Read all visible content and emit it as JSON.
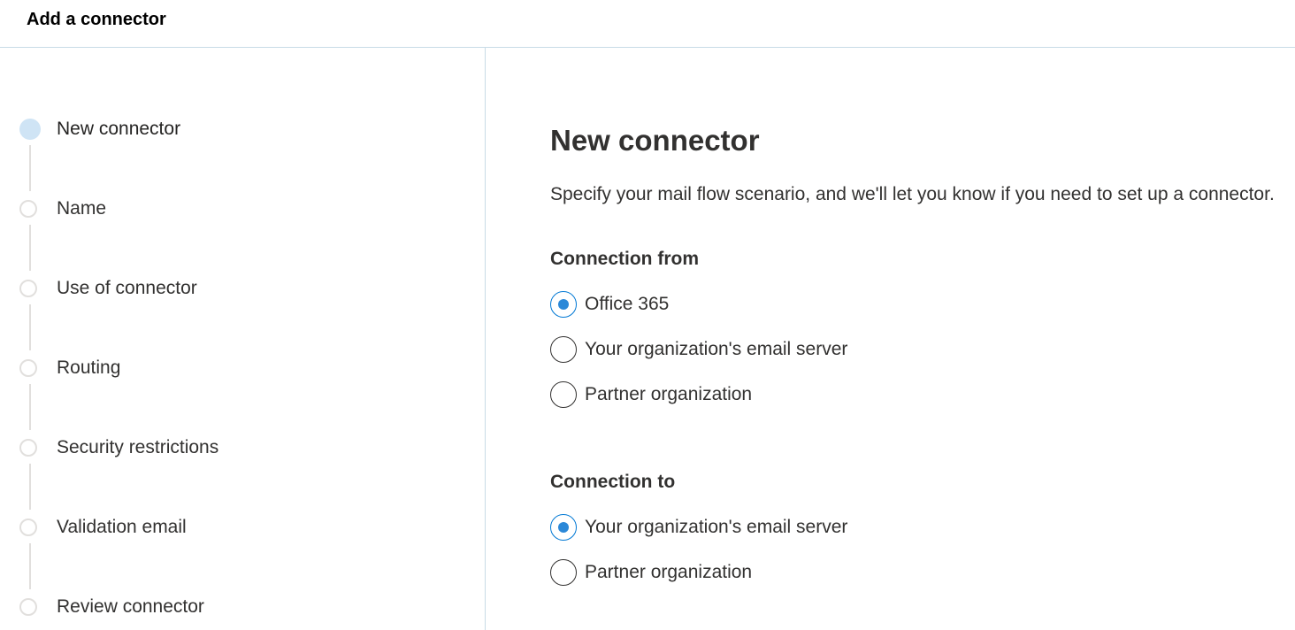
{
  "header": {
    "title": "Add a connector"
  },
  "steps": [
    {
      "label": "New connector",
      "active": true
    },
    {
      "label": "Name",
      "active": false
    },
    {
      "label": "Use of connector",
      "active": false
    },
    {
      "label": "Routing",
      "active": false
    },
    {
      "label": "Security restrictions",
      "active": false
    },
    {
      "label": "Validation email",
      "active": false
    },
    {
      "label": "Review connector",
      "active": false
    }
  ],
  "main": {
    "title": "New connector",
    "description": "Specify your mail flow scenario, and we'll let you know if you need to set up a connector.",
    "connection_from": {
      "label": "Connection from",
      "options": [
        {
          "label": "Office 365",
          "checked": true
        },
        {
          "label": "Your organization's email server",
          "checked": false
        },
        {
          "label": "Partner organization",
          "checked": false
        }
      ]
    },
    "connection_to": {
      "label": "Connection to",
      "options": [
        {
          "label": "Your organization's email server",
          "checked": true
        },
        {
          "label": "Partner organization",
          "checked": false
        }
      ]
    }
  },
  "colors": {
    "accent": "#0078d4",
    "active_step": "#cfe4f5",
    "divider": "#c8dbe6"
  }
}
